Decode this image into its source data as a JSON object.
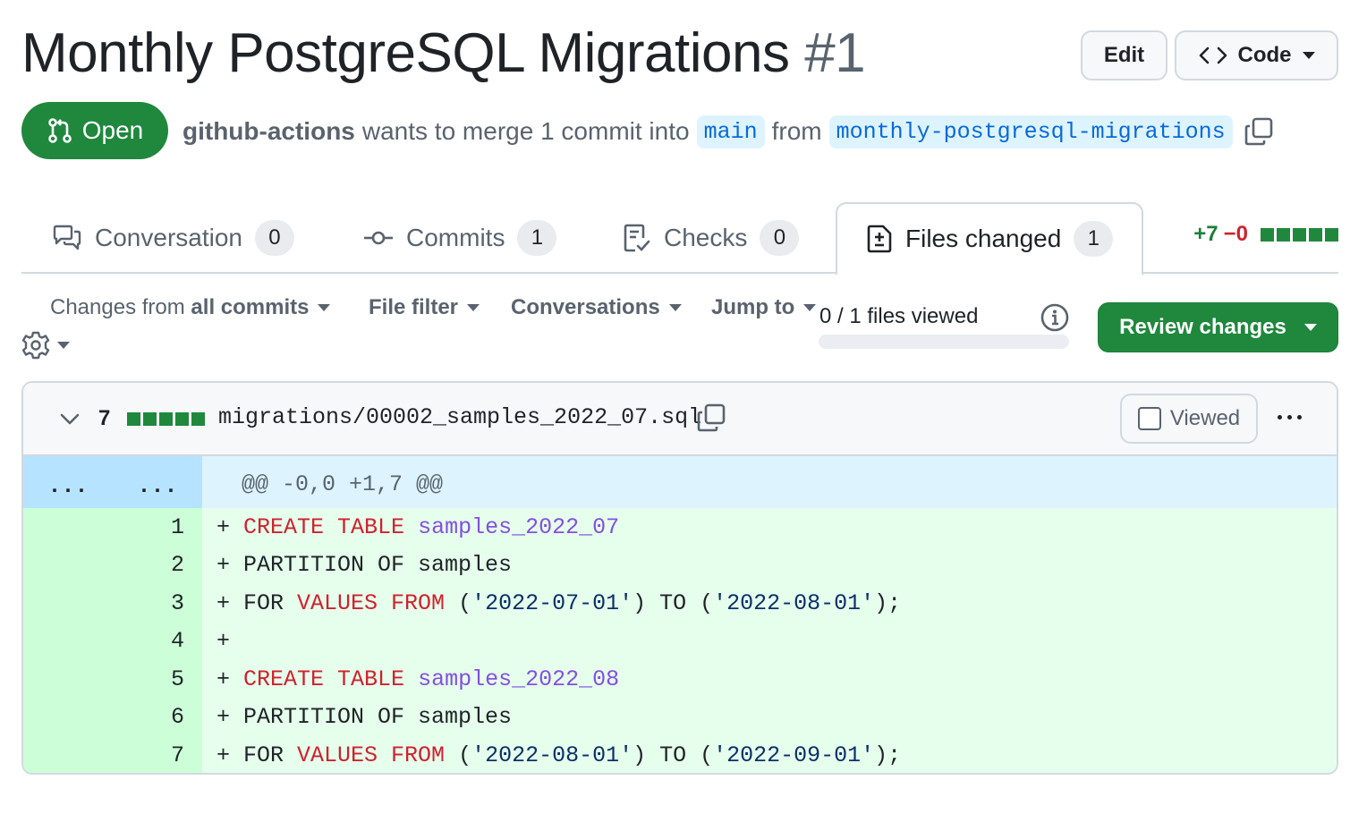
{
  "header": {
    "title": "Monthly PostgreSQL Migrations",
    "number": "#1",
    "edit_label": "Edit",
    "code_label": "Code"
  },
  "status": {
    "state": "Open",
    "author": "github-actions",
    "merge_text": "wants to merge 1 commit into",
    "base_branch": "main",
    "from_text": "from",
    "head_branch": "monthly-postgresql-migrations"
  },
  "tabs": [
    {
      "label": "Conversation",
      "count": "0",
      "icon": "comment-discussion-icon"
    },
    {
      "label": "Commits",
      "count": "1",
      "icon": "git-commit-icon"
    },
    {
      "label": "Checks",
      "count": "0",
      "icon": "checklist-icon"
    },
    {
      "label": "Files changed",
      "count": "1",
      "icon": "file-diff-icon",
      "active": true
    }
  ],
  "diffstat": {
    "additions": "+7",
    "deletions": "−0"
  },
  "toolbar": {
    "changes_prefix": "Changes from",
    "changes_value": "all commits",
    "file_filter": "File filter",
    "conversations": "Conversations",
    "jump_to": "Jump to",
    "viewed_count": "0 / 1 files viewed",
    "viewed_progress": 0,
    "review_label": "Review changes"
  },
  "file": {
    "changes": "7",
    "path": "migrations/00002_samples_2022_07.sql",
    "viewed_label": "Viewed",
    "hunk_header": "@@ -0,0 +1,7 @@",
    "hunk_expand_old": "...",
    "hunk_expand_new": "...",
    "lines": [
      {
        "num": "1",
        "tokens": [
          [
            "p",
            "+ "
          ],
          [
            "kw",
            "CREATE"
          ],
          [
            "p",
            " "
          ],
          [
            "kw",
            "TABLE"
          ],
          [
            "p",
            " "
          ],
          [
            "ent",
            "samples_2022_07"
          ]
        ]
      },
      {
        "num": "2",
        "tokens": [
          [
            "p",
            "+ PARTITION OF samples"
          ]
        ]
      },
      {
        "num": "3",
        "tokens": [
          [
            "p",
            "+ FOR "
          ],
          [
            "kw",
            "VALUES"
          ],
          [
            "p",
            " "
          ],
          [
            "kw",
            "FROM"
          ],
          [
            "p",
            " ("
          ],
          [
            "str",
            "'2022-07-01'"
          ],
          [
            "p",
            ") TO ("
          ],
          [
            "str",
            "'2022-08-01'"
          ],
          [
            "p",
            ");"
          ]
        ]
      },
      {
        "num": "4",
        "tokens": [
          [
            "p",
            "+"
          ]
        ]
      },
      {
        "num": "5",
        "tokens": [
          [
            "p",
            "+ "
          ],
          [
            "kw",
            "CREATE"
          ],
          [
            "p",
            " "
          ],
          [
            "kw",
            "TABLE"
          ],
          [
            "p",
            " "
          ],
          [
            "ent",
            "samples_2022_08"
          ]
        ]
      },
      {
        "num": "6",
        "tokens": [
          [
            "p",
            "+ PARTITION OF samples"
          ]
        ]
      },
      {
        "num": "7",
        "tokens": [
          [
            "p",
            "+ FOR "
          ],
          [
            "kw",
            "VALUES"
          ],
          [
            "p",
            " "
          ],
          [
            "kw",
            "FROM"
          ],
          [
            "p",
            " ("
          ],
          [
            "str",
            "'2022-08-01'"
          ],
          [
            "p",
            ") TO ("
          ],
          [
            "str",
            "'2022-09-01'"
          ],
          [
            "p",
            ");"
          ]
        ]
      }
    ]
  }
}
